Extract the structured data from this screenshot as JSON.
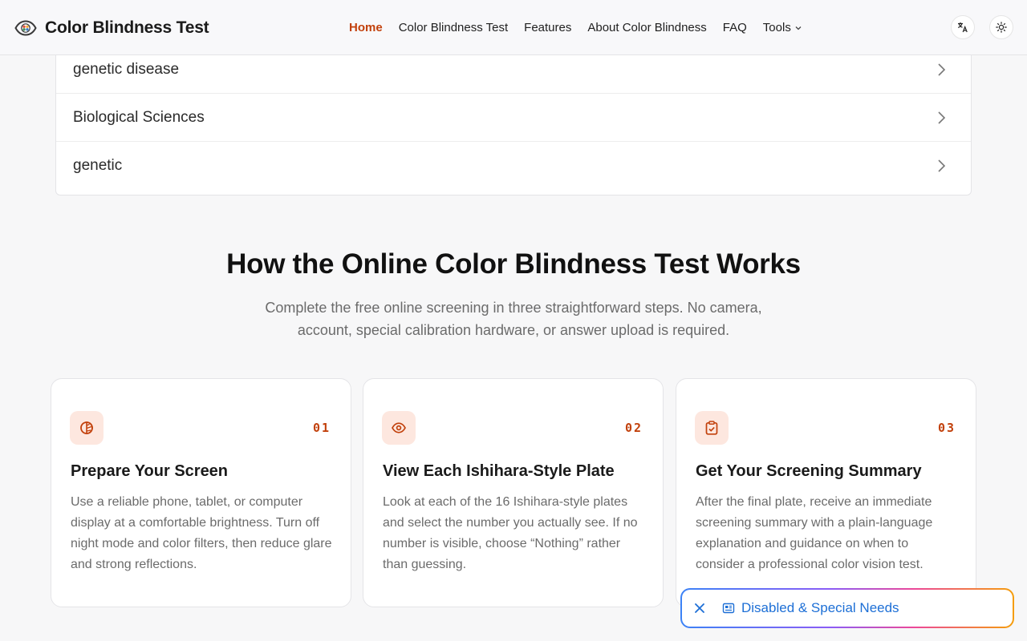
{
  "header": {
    "brand_title": "Color Blindness Test",
    "nav": [
      {
        "label": "Home",
        "active": true
      },
      {
        "label": "Color Blindness Test"
      },
      {
        "label": "Features"
      },
      {
        "label": "About Color Blindness"
      },
      {
        "label": "FAQ"
      },
      {
        "label": "Tools",
        "has_dropdown": true
      }
    ],
    "icons": {
      "language": "translate-icon",
      "theme": "sun-icon",
      "logo": "eye-icon"
    }
  },
  "related_topics": [
    {
      "label": "genetic disease"
    },
    {
      "label": "Biological Sciences"
    },
    {
      "label": "genetic"
    }
  ],
  "how_it_works": {
    "title": "How the Online Color Blindness Test Works",
    "subtitle": "Complete the free online screening in three straightforward steps. No camera, account, special calibration hardware, or answer upload is required.",
    "steps": [
      {
        "number": "01",
        "icon": "contrast-icon",
        "title": "Prepare Your Screen",
        "description": "Use a reliable phone, tablet, or computer display at a comfortable brightness. Turn off night mode and color filters, then reduce glare and strong reflections."
      },
      {
        "number": "02",
        "icon": "eye-icon",
        "title": "View Each Ishihara-Style Plate",
        "description": "Look at each of the 16 Ishihara-style plates and select the number you actually see. If no number is visible, choose “Nothing” rather than guessing."
      },
      {
        "number": "03",
        "icon": "clipboard-check-icon",
        "title": "Get Your Screening Summary",
        "description": "After the final plate, receive an immediate screening summary with a plain-language explanation and guidance on when to consider a professional color vision test."
      }
    ]
  },
  "floating_pill": {
    "label": "Disabled & Special Needs",
    "close_icon": "close-icon",
    "doc_icon": "newspaper-icon"
  },
  "colors": {
    "accent": "#c2410c",
    "icon_bg": "#fde7df",
    "link_blue": "#1d6fd6"
  }
}
